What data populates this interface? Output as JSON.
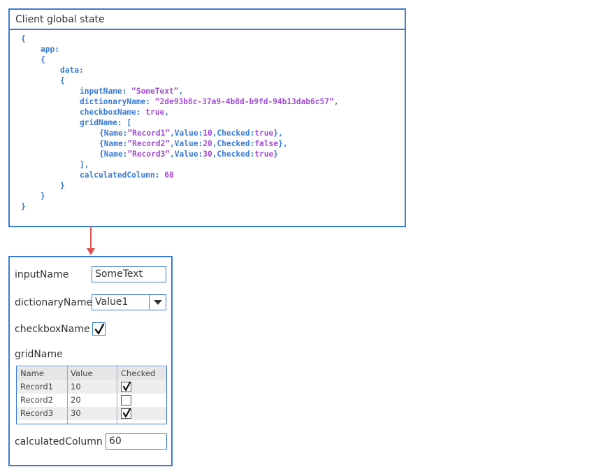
{
  "state_panel": {
    "title": "Client global state",
    "code_lines": [
      {
        "indent": 0,
        "tokens": [
          [
            "punc",
            "{"
          ]
        ]
      },
      {
        "indent": 1,
        "tokens": [
          [
            "key",
            "app:"
          ]
        ]
      },
      {
        "indent": 1,
        "tokens": [
          [
            "punc",
            "{"
          ]
        ]
      },
      {
        "indent": 2,
        "tokens": [
          [
            "key",
            "data:"
          ]
        ]
      },
      {
        "indent": 2,
        "tokens": [
          [
            "punc",
            "{"
          ]
        ]
      },
      {
        "indent": 3,
        "tokens": [
          [
            "key",
            "inputName: "
          ],
          [
            "str",
            "“SomeText”"
          ],
          [
            "punc",
            ","
          ]
        ]
      },
      {
        "indent": 3,
        "tokens": [
          [
            "key",
            "dictionaryName: "
          ],
          [
            "str",
            "“2de93b8c-37a9-4b8d-b9fd-94b13dab6c57”"
          ],
          [
            "punc",
            ","
          ]
        ]
      },
      {
        "indent": 3,
        "tokens": [
          [
            "key",
            "checkboxName: "
          ],
          [
            "str",
            "true"
          ],
          [
            "punc",
            ","
          ]
        ]
      },
      {
        "indent": 3,
        "tokens": [
          [
            "key",
            "gridName: "
          ],
          [
            "punc",
            "["
          ]
        ]
      },
      {
        "indent": 4,
        "tokens": [
          [
            "punc",
            "{Name:"
          ],
          [
            "str",
            "”Record1”"
          ],
          [
            "punc",
            ",Value:"
          ],
          [
            "num",
            "10"
          ],
          [
            "punc",
            ",Checked:"
          ],
          [
            "str",
            "true"
          ],
          [
            "punc",
            "},"
          ]
        ]
      },
      {
        "indent": 4,
        "tokens": [
          [
            "punc",
            "{Name:"
          ],
          [
            "str",
            "”Record2”"
          ],
          [
            "punc",
            ",Value:"
          ],
          [
            "num",
            "20"
          ],
          [
            "punc",
            ",Checked:"
          ],
          [
            "str",
            "false"
          ],
          [
            "punc",
            "},"
          ]
        ]
      },
      {
        "indent": 4,
        "tokens": [
          [
            "punc",
            "{Name:"
          ],
          [
            "str",
            "”Record3”"
          ],
          [
            "punc",
            ",Value:"
          ],
          [
            "num",
            "30"
          ],
          [
            "punc",
            ",Checked:"
          ],
          [
            "str",
            "true"
          ],
          [
            "punc",
            "}"
          ]
        ]
      },
      {
        "indent": 3,
        "tokens": [
          [
            "punc",
            "],"
          ]
        ]
      },
      {
        "indent": 3,
        "tokens": [
          [
            "key",
            "calculatedColumn: "
          ],
          [
            "num",
            "60"
          ]
        ]
      },
      {
        "indent": 2,
        "tokens": [
          [
            "punc",
            "}"
          ]
        ]
      },
      {
        "indent": 1,
        "tokens": [
          [
            "punc",
            "}"
          ]
        ]
      },
      {
        "indent": 0,
        "tokens": [
          [
            "punc",
            "}"
          ]
        ]
      }
    ]
  },
  "form": {
    "input_name": {
      "label": "inputName",
      "value": "SomeText"
    },
    "dictionary_name": {
      "label": "dictionaryName",
      "value": "Value1"
    },
    "checkbox_name": {
      "label": "checkboxName",
      "checked": true
    },
    "grid_name": {
      "label": "gridName",
      "columns": [
        "Name",
        "Value",
        "Checked"
      ],
      "rows": [
        {
          "name": "Record1",
          "value": "10",
          "checked": true
        },
        {
          "name": "Record2",
          "value": "20",
          "checked": false
        },
        {
          "name": "Record3",
          "value": "30",
          "checked": true
        }
      ]
    },
    "calculated_column": {
      "label": "calculatedColumn",
      "value": "60"
    }
  },
  "colors": {
    "border": "#3a7bd5",
    "key_text": "#3a7bd5",
    "value_text": "#a24bd8",
    "arrow": "#e05050"
  },
  "icons": {
    "arrow": "arrow-down-icon",
    "dropdown": "chevron-down-icon",
    "check": "checkmark-icon"
  }
}
